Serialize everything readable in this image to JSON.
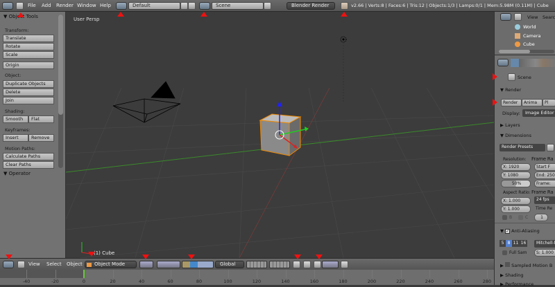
{
  "topbar": {
    "menus": [
      "File",
      "Add",
      "Render",
      "Window",
      "Help"
    ],
    "layout": "Default",
    "scene": "Scene",
    "engine": "Blender Render",
    "stats": "v2.66 | Verts:8 | Faces:6 | Tris:12 | Objects:1/3 | Lamps:0/1 | Mem:5.98M (0.11M) | Cube"
  },
  "tools": {
    "title": "Object Tools",
    "transform": "Transform:",
    "translate": "Translate",
    "rotate": "Rotate",
    "scale": "Scale",
    "origin": "Origin",
    "object": "Object:",
    "duplicate": "Duplicate Objects",
    "delete": "Delete",
    "join": "Join",
    "shading": "Shading:",
    "smooth": "Smooth",
    "flat": "Flat",
    "keyframes": "Keyframes:",
    "insert": "Insert",
    "remove": "Remove",
    "motion": "Motion Paths:",
    "calc": "Calculate Paths",
    "clear": "Clear Paths",
    "operator": "Operator"
  },
  "viewport": {
    "label": "User Persp",
    "object": "(1) Cube"
  },
  "outliner": {
    "view": "View",
    "search": "Search",
    "items": [
      "World",
      "Camera",
      "Cube"
    ]
  },
  "props": {
    "scene": "Scene",
    "render": "Render",
    "tabs": [
      "Render",
      "Anima",
      "Pl"
    ],
    "display_label": "Display:",
    "display": "Image Editor",
    "layers": "Layers",
    "dimensions": "Dimensions",
    "presets": "Render Presets",
    "resolution": "Resolution:",
    "res_x": "X: 1920",
    "res_y": "Y: 1080",
    "res_pct": "50%",
    "frame_range": "Frame Ra",
    "start": "Start F",
    "end": "End: 250",
    "frame": "Frame:",
    "aspect": "Aspect Ratio:",
    "asp_x": "X: 1.000",
    "asp_y": "Y: 1.000",
    "frame_rate": "Frame Ra",
    "fps": "24 fps",
    "time_remap": "Time Re",
    "b": "B",
    "c": "C",
    "remap": "1",
    "aa": "Anti-Aliasing",
    "aa_samples": [
      "5",
      "8",
      "11",
      "16"
    ],
    "filter": "Mitchell-N",
    "full_sample": "Full Sam",
    "size": "S: 1.000",
    "motion_blur": "Sampled Motion B",
    "shading": "Shading",
    "performance": "Performance"
  },
  "header": {
    "view": "View",
    "select": "Select",
    "object": "Object",
    "mode": "Object Mode",
    "orientation": "Global"
  },
  "timeline": {
    "ticks": [
      -40,
      -20,
      0,
      20,
      40,
      60,
      80,
      100,
      120,
      140,
      160,
      180,
      200,
      220,
      240,
      260,
      280
    ],
    "current_frame": 0
  }
}
